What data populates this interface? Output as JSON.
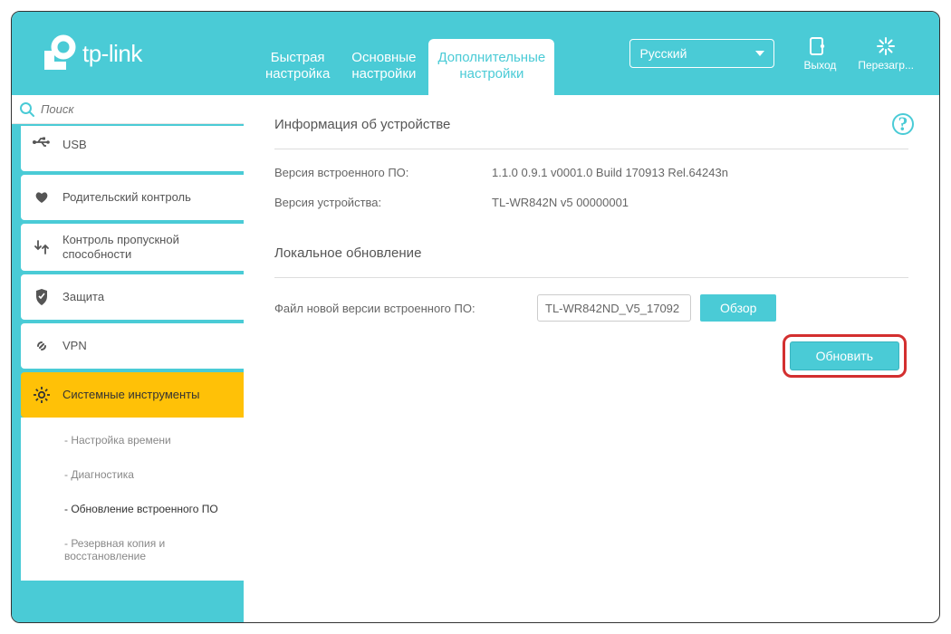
{
  "brand": "tp-link",
  "nav": {
    "quick": "Быстрая\nнастройка",
    "basic": "Основные\nнастройки",
    "advanced": "Дополнительные\nнастройки"
  },
  "language": "Русский",
  "header_actions": {
    "logout": "Выход",
    "reboot": "Перезагр..."
  },
  "search": {
    "placeholder": "Поиск"
  },
  "sidebar": {
    "items": [
      {
        "label": "USB"
      },
      {
        "label": "Родительский контроль"
      },
      {
        "label": "Контроль пропускной способности"
      },
      {
        "label": "Защита"
      },
      {
        "label": "VPN"
      },
      {
        "label": "Системные инструменты"
      }
    ],
    "submenu": [
      {
        "label": "- Настройка времени"
      },
      {
        "label": "- Диагностика"
      },
      {
        "label": "- Обновление встроенного ПО"
      },
      {
        "label": "- Резервная копия и восстановление"
      }
    ]
  },
  "content": {
    "device_info_title": "Информация об устройстве",
    "fw_label": "Версия встроенного ПО:",
    "fw_value": "1.1.0 0.9.1 v0001.0 Build 170913 Rel.64243n",
    "hw_label": "Версия устройства:",
    "hw_value": "TL-WR842N v5 00000001",
    "local_upgrade_title": "Локальное обновление",
    "file_label": "Файл новой версии встроенного ПО:",
    "file_value": "TL-WR842ND_V5_17092",
    "browse": "Обзор",
    "update": "Обновить"
  }
}
